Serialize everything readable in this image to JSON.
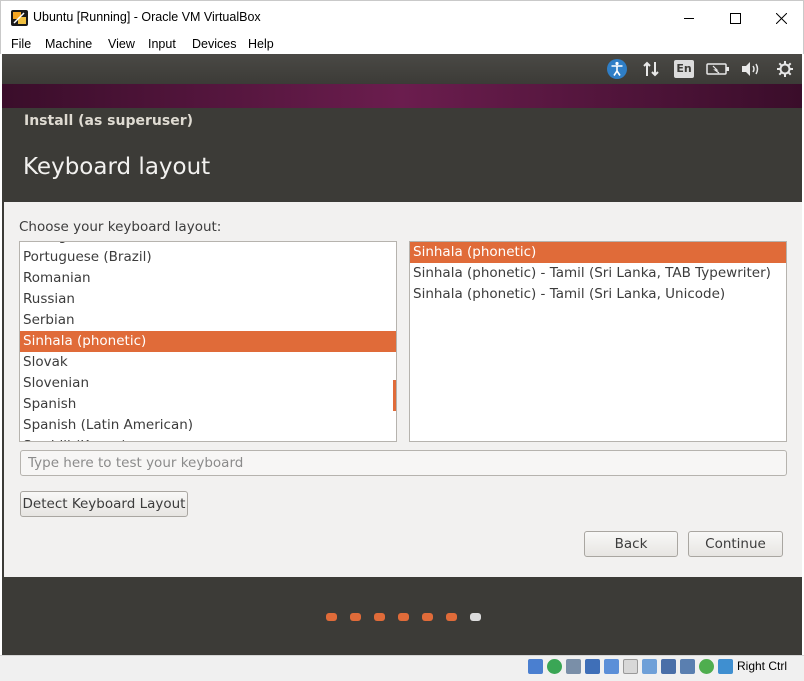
{
  "window": {
    "title": "Ubuntu [Running] - Oracle VM VirtualBox",
    "menu": [
      "File",
      "Machine",
      "View",
      "Input",
      "Devices",
      "Help"
    ]
  },
  "panel": {
    "language_indicator": "En",
    "icons": [
      "accessibility-icon",
      "network-icon",
      "language-icon",
      "battery-icon",
      "volume-icon",
      "settings-gear-icon"
    ]
  },
  "installer": {
    "window_title": "Install (as superuser)",
    "page_title": "Keyboard layout",
    "choose_label": "Choose your keyboard layout:",
    "layouts": [
      {
        "label": "Portuguese (Brazil)",
        "selected": false
      },
      {
        "label": "Romanian",
        "selected": false
      },
      {
        "label": "Russian",
        "selected": false
      },
      {
        "label": "Serbian",
        "selected": false
      },
      {
        "label": "Sinhala (phonetic)",
        "selected": true
      },
      {
        "label": "Slovak",
        "selected": false
      },
      {
        "label": "Slovenian",
        "selected": false
      },
      {
        "label": "Spanish",
        "selected": false
      },
      {
        "label": "Spanish (Latin American)",
        "selected": false
      }
    ],
    "variants": [
      {
        "label": "Sinhala (phonetic)",
        "selected": true
      },
      {
        "label": "Sinhala (phonetic) - Tamil (Sri Lanka, TAB Typewriter)",
        "selected": false
      },
      {
        "label": "Sinhala (phonetic) - Tamil (Sri Lanka, Unicode)",
        "selected": false
      }
    ],
    "test_placeholder": "Type here to test your keyboard",
    "test_value": "",
    "detect_button": "Detect Keyboard Layout",
    "back_button": "Back",
    "continue_button": "Continue",
    "progress": {
      "total_steps": 7,
      "current_step": 7
    }
  },
  "statusbar": {
    "host_key": "Right Ctrl"
  },
  "colors": {
    "accent": "#e06b39",
    "dark_panel": "#3c3b37",
    "content_bg": "#f2f1f0"
  }
}
